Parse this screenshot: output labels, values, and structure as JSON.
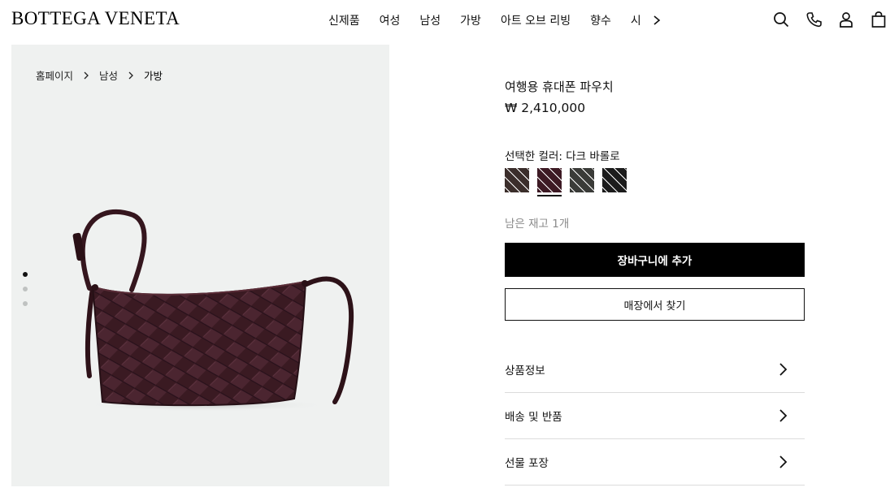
{
  "header": {
    "logo": "BOTTEGA VENETA",
    "nav": [
      "신제품",
      "여성",
      "남성",
      "가방",
      "아트 오브 리빙",
      "향수",
      "시"
    ],
    "icons": [
      "search-icon",
      "phone-icon",
      "account-icon",
      "shopping-bag-icon"
    ]
  },
  "gallery": {
    "breadcrumb": [
      "홈페이지",
      "남성",
      "가방"
    ],
    "slides": 3,
    "active_slide": 1
  },
  "product": {
    "name": "여행용 휴대폰 파우치",
    "price": "₩ 2,410,000",
    "color_label": "선택한 컬러: 다크 바롤로",
    "swatches": [
      {
        "name": "dark-brown",
        "color": "#3b2e2b",
        "selected": false
      },
      {
        "name": "dark-barolo",
        "color": "#3d1a24",
        "selected": true
      },
      {
        "name": "dark-grey",
        "color": "#3a3b38",
        "selected": false
      },
      {
        "name": "black",
        "color": "#1c1c1c",
        "selected": false
      }
    ],
    "stock": "남은 재고 1개",
    "add_to_cart": "장바구니에 추가",
    "find_in_store": "매장에서 찾기"
  },
  "accordion": [
    {
      "label": "상품정보"
    },
    {
      "label": "배송 및 반품"
    },
    {
      "label": "선물 포장"
    }
  ]
}
